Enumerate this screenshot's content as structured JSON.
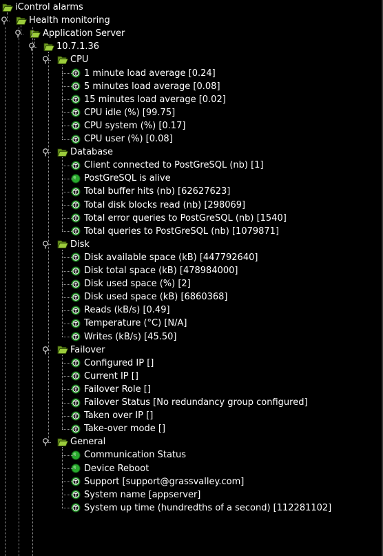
{
  "colors": {
    "background": "#000000",
    "text": "#ffffff",
    "folder": "#9ccc3c",
    "status_ok": "#27a82c",
    "tree_line": "#9a9a9a"
  },
  "tree": {
    "label": "iControl alarms",
    "icon": "open-folder-icon",
    "children": [
      {
        "label": "Health monitoring",
        "icon": "open-folder-icon",
        "children": [
          {
            "label": "Application Server",
            "icon": "open-folder-icon",
            "children": [
              {
                "label": "10.7.1.36",
                "icon": "open-folder-icon",
                "children": [
                  {
                    "label": "CPU",
                    "icon": "open-folder-icon",
                    "children": [
                      {
                        "label": "1 minute load average [0.24]",
                        "icon": "threshold-icon"
                      },
                      {
                        "label": "5 minutes load average [0.08]",
                        "icon": "threshold-icon"
                      },
                      {
                        "label": "15 minutes load average [0.02]",
                        "icon": "threshold-icon"
                      },
                      {
                        "label": "CPU idle (%) [99.75]",
                        "icon": "threshold-icon"
                      },
                      {
                        "label": "CPU system (%) [0.17]",
                        "icon": "threshold-icon"
                      },
                      {
                        "label": "CPU user (%) [0.08]",
                        "icon": "threshold-icon"
                      }
                    ]
                  },
                  {
                    "label": "Database",
                    "icon": "open-folder-icon",
                    "children": [
                      {
                        "label": "Client connected to PostGreSQL (nb) [1]",
                        "icon": "threshold-icon"
                      },
                      {
                        "label": "PostGreSQL is alive",
                        "icon": "status-ok-icon"
                      },
                      {
                        "label": "Total buffer hits (nb) [62627623]",
                        "icon": "threshold-icon"
                      },
                      {
                        "label": "Total disk blocks read (nb) [298069]",
                        "icon": "threshold-icon"
                      },
                      {
                        "label": "Total error queries to PostGreSQL (nb) [1540]",
                        "icon": "threshold-icon"
                      },
                      {
                        "label": "Total queries to PostGreSQL (nb) [1079871]",
                        "icon": "threshold-icon"
                      }
                    ]
                  },
                  {
                    "label": "Disk",
                    "icon": "open-folder-icon",
                    "children": [
                      {
                        "label": "Disk available space (kB) [447792640]",
                        "icon": "threshold-icon"
                      },
                      {
                        "label": "Disk total space (kB) [478984000]",
                        "icon": "threshold-icon"
                      },
                      {
                        "label": "Disk used space (%) [2]",
                        "icon": "threshold-icon"
                      },
                      {
                        "label": "Disk used space (kB) [6860368]",
                        "icon": "threshold-icon"
                      },
                      {
                        "label": "Reads (kB/s) [0.49]",
                        "icon": "threshold-icon"
                      },
                      {
                        "label": "Temperature (°C) [N/A]",
                        "icon": "threshold-icon"
                      },
                      {
                        "label": "Writes (kB/s) [45.50]",
                        "icon": "threshold-icon"
                      }
                    ]
                  },
                  {
                    "label": "Failover",
                    "icon": "open-folder-icon",
                    "children": [
                      {
                        "label": "Configured IP []",
                        "icon": "threshold-icon"
                      },
                      {
                        "label": "Current IP []",
                        "icon": "threshold-icon"
                      },
                      {
                        "label": "Failover Role []",
                        "icon": "threshold-icon"
                      },
                      {
                        "label": "Failover Status [No redundancy group configured]",
                        "icon": "threshold-icon"
                      },
                      {
                        "label": "Taken over IP []",
                        "icon": "threshold-icon"
                      },
                      {
                        "label": "Take-over mode []",
                        "icon": "threshold-icon"
                      }
                    ]
                  },
                  {
                    "label": "General",
                    "icon": "open-folder-icon",
                    "children": [
                      {
                        "label": "Communication Status",
                        "icon": "status-ok-icon"
                      },
                      {
                        "label": "Device Reboot",
                        "icon": "status-ok-icon"
                      },
                      {
                        "label": "Support [support@grassvalley.com]",
                        "icon": "threshold-icon"
                      },
                      {
                        "label": "System name [appserver]",
                        "icon": "threshold-icon"
                      },
                      {
                        "label": "System up time (hundredths of a second) [112281102]",
                        "icon": "threshold-icon"
                      }
                    ]
                  }
                ]
              }
            ]
          }
        ]
      }
    ]
  }
}
